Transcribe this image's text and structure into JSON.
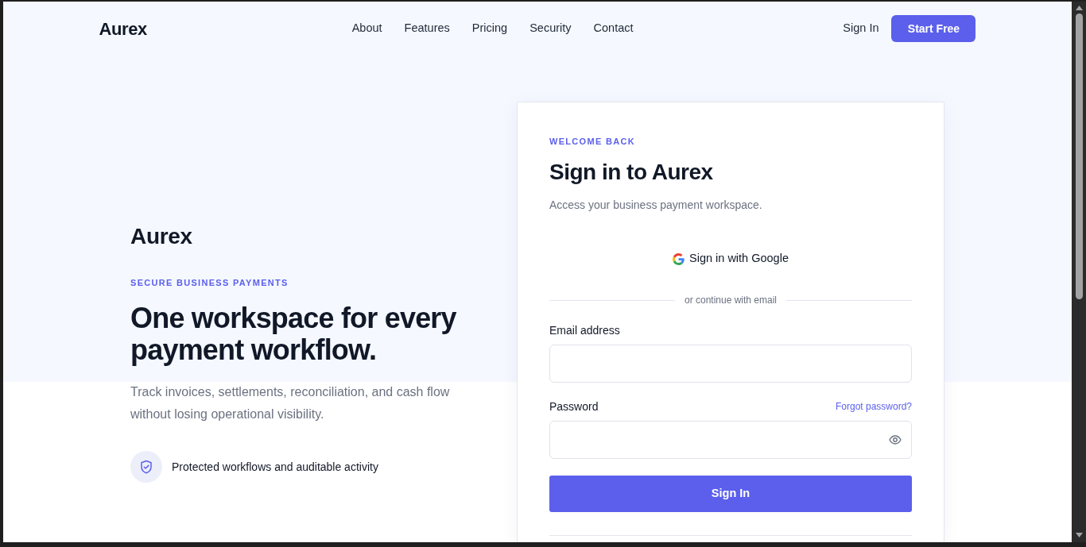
{
  "nav": {
    "logo": "Aurex",
    "links": [
      {
        "label": "About"
      },
      {
        "label": "Features"
      },
      {
        "label": "Pricing"
      },
      {
        "label": "Security"
      },
      {
        "label": "Contact"
      }
    ],
    "sign_in": "Sign In",
    "cta": "Start Free"
  },
  "hero": {
    "brand": "Aurex",
    "eyebrow": "SECURE BUSINESS PAYMENTS",
    "headline": "One workspace for every payment workflow.",
    "description": "Track invoices, settlements, reconciliation, and cash flow without losing operational visibility.",
    "feature": "Protected workflows and auditable activity"
  },
  "login_card": {
    "eyebrow": "WELCOME BACK",
    "title": "Sign in to Aurex",
    "subtitle": "Access your business payment workspace.",
    "google_button": "Sign in with Google",
    "divider": "or continue with email",
    "fields": [
      {
        "kind": "email",
        "label": "Email address"
      },
      {
        "kind": "password",
        "label": "Password",
        "link": "Forgot password?"
      }
    ],
    "submit": "Sign In"
  }
}
